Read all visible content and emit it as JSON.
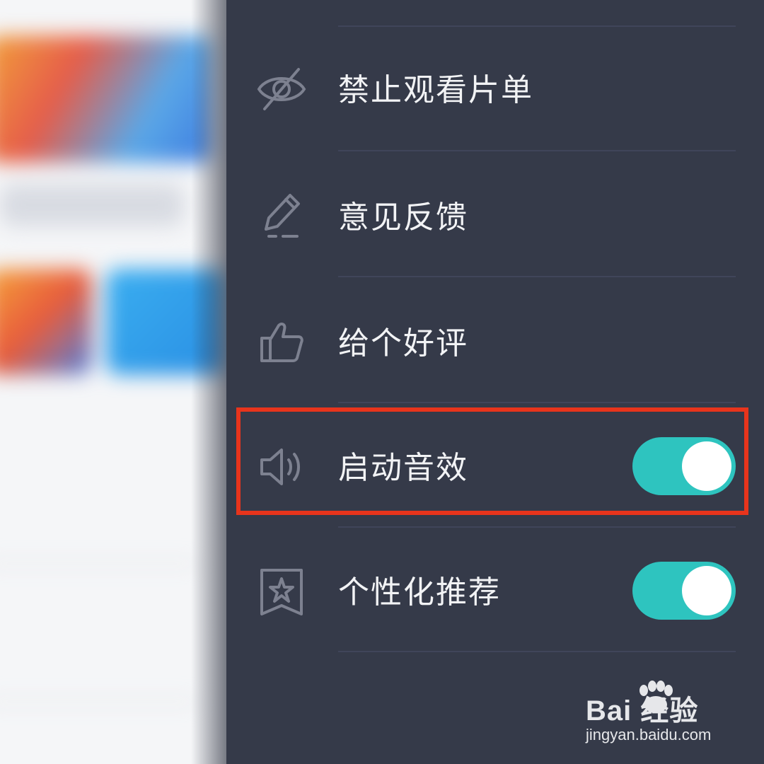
{
  "menu": {
    "items": [
      {
        "label": "禁止观看片单",
        "icon": "eye-slash-icon"
      },
      {
        "label": "意见反馈",
        "icon": "pencil-icon"
      },
      {
        "label": "给个好评",
        "icon": "thumbs-up-icon"
      },
      {
        "label": "启动音效",
        "icon": "speaker-icon",
        "toggle": true,
        "on": true
      },
      {
        "label": "个性化推荐",
        "icon": "bookmark-star-icon",
        "toggle": true,
        "on": true
      }
    ]
  },
  "colors": {
    "drawer_bg": "#353a49",
    "toggle_on": "#2ec4bf",
    "highlight": "#e8341c",
    "text": "#f2f3f5"
  },
  "watermark": {
    "brand": "Bai 经验",
    "url": "jingyan.baidu.com"
  }
}
